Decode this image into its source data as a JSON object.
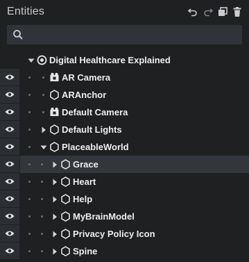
{
  "panel": {
    "title": "Entities",
    "toolbar": {
      "undo_icon": "undo-icon",
      "redo_icon": "redo-icon",
      "duplicate_icon": "duplicate-icon",
      "delete_icon": "trash-icon"
    },
    "search": {
      "value": "",
      "placeholder": "",
      "icon": "search-icon"
    }
  },
  "colors": {
    "background": "#1e2022",
    "visibility_column": "#2b2e33",
    "search_background": "#30343a",
    "selected_row": "#33373d",
    "text": "#eceeef"
  },
  "tree": {
    "root": {
      "label": "Digital Healthcare Explained",
      "icon": "scene-icon",
      "expanded": true
    },
    "items": [
      {
        "label": "AR Camera",
        "icon": "camera-icon",
        "depth": 1,
        "has_children": false,
        "expanded": false,
        "selected": false
      },
      {
        "label": "ARAnchor",
        "icon": "hexagon-entity-icon",
        "depth": 1,
        "has_children": false,
        "expanded": false,
        "selected": false
      },
      {
        "label": "Default Camera",
        "icon": "camera-icon",
        "depth": 1,
        "has_children": false,
        "expanded": false,
        "selected": false
      },
      {
        "label": "Default Lights",
        "icon": "hexagon-entity-icon",
        "depth": 1,
        "has_children": true,
        "expanded": false,
        "selected": false
      },
      {
        "label": "PlaceableWorld",
        "icon": "hexagon-entity-icon",
        "depth": 1,
        "has_children": true,
        "expanded": true,
        "selected": false
      },
      {
        "label": "Grace",
        "icon": "hexagon-entity-icon",
        "depth": 2,
        "has_children": true,
        "expanded": false,
        "selected": true
      },
      {
        "label": "Heart",
        "icon": "hexagon-entity-icon",
        "depth": 2,
        "has_children": true,
        "expanded": false,
        "selected": false
      },
      {
        "label": "Help",
        "icon": "hexagon-entity-icon",
        "depth": 2,
        "has_children": true,
        "expanded": false,
        "selected": false
      },
      {
        "label": "MyBrainModel",
        "icon": "hexagon-entity-icon",
        "depth": 2,
        "has_children": true,
        "expanded": false,
        "selected": false
      },
      {
        "label": "Privacy Policy Icon",
        "icon": "hexagon-entity-icon",
        "depth": 2,
        "has_children": true,
        "expanded": false,
        "selected": false
      },
      {
        "label": "Spine",
        "icon": "hexagon-entity-icon",
        "depth": 2,
        "has_children": true,
        "expanded": false,
        "selected": false
      }
    ]
  }
}
